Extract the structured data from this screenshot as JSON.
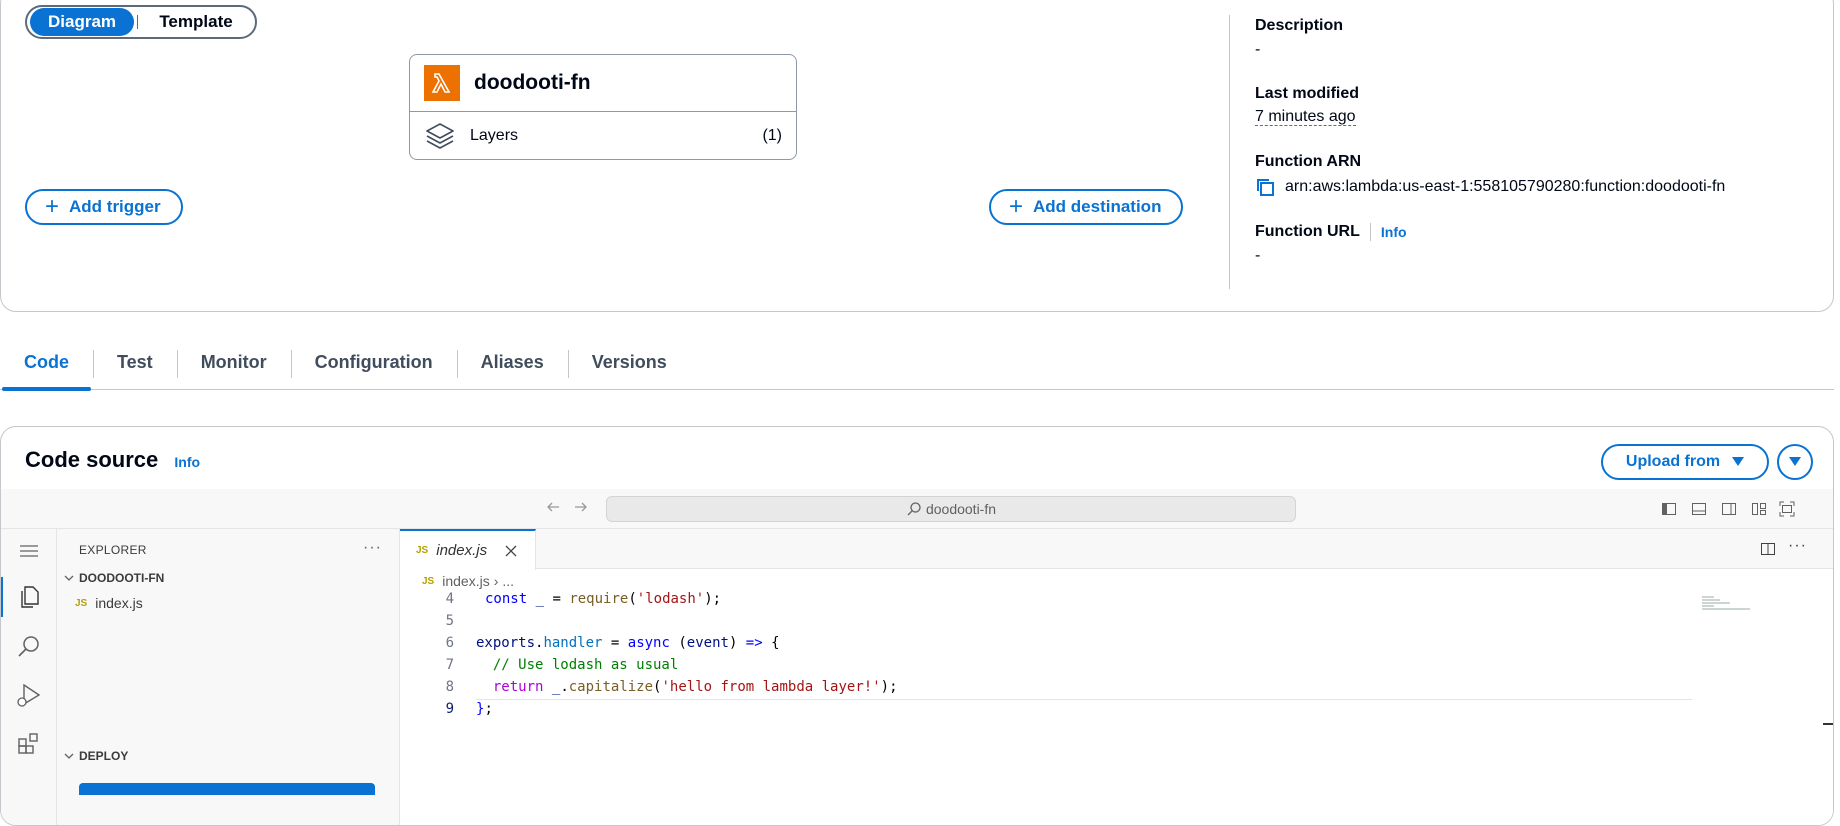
{
  "view_toggle": {
    "diagram": "Diagram",
    "template": "Template"
  },
  "function_box": {
    "name": "doodooti-fn",
    "layers_label": "Layers",
    "layers_count": "(1)"
  },
  "buttons": {
    "add_trigger": "Add trigger",
    "add_destination": "Add destination",
    "upload_from": "Upload from"
  },
  "properties": {
    "description_label": "Description",
    "description_value": "-",
    "last_modified_label": "Last modified",
    "last_modified_value": "7 minutes ago",
    "arn_label": "Function ARN",
    "arn_value": "arn:aws:lambda:us-east-1:558105790280:function:doodooti-fn",
    "url_label": "Function URL",
    "url_info": "Info",
    "url_value": "-"
  },
  "tabs": [
    "Code",
    "Test",
    "Monitor",
    "Configuration",
    "Aliases",
    "Versions"
  ],
  "code_source": {
    "title": "Code source",
    "info": "Info"
  },
  "ide": {
    "search_placeholder": "doodooti-fn",
    "explorer_header": "EXPLORER",
    "folder": "DOODOOTI-FN",
    "file": "index.js",
    "deploy_section": "DEPLOY",
    "open_tab": "index.js",
    "breadcrumb_file": "index.js",
    "breadcrumb_rest": "...",
    "lines": [
      {
        "n": "4",
        "text": "const _ = require('lodash');"
      },
      {
        "n": "5",
        "text": ""
      },
      {
        "n": "6",
        "text": "exports.handler = async (event) => {"
      },
      {
        "n": "7",
        "text": "  // Use lodash as usual"
      },
      {
        "n": "8",
        "text": "  return _.capitalize('hello from lambda layer!');"
      },
      {
        "n": "9",
        "text": "};"
      }
    ]
  },
  "colors": {
    "accent": "#0972d3",
    "lambda_orange": "#ed7100"
  }
}
